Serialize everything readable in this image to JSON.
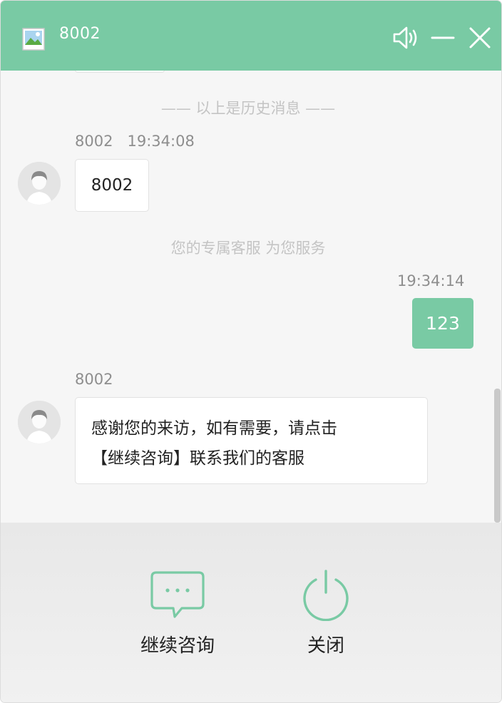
{
  "header": {
    "title": "8002"
  },
  "notes": {
    "history": "—— 以上是历史消息 ——",
    "service": "您的专属客服 为您服务"
  },
  "messages": [
    {
      "sender": "8002",
      "time": "19:34:08",
      "text": "8002"
    },
    {
      "time": "19:34:14",
      "text": "123"
    },
    {
      "sender": "8002",
      "text_line1": "感谢您的来访，如有需要，请点击",
      "text_line2": "【继续咨询】联系我们的客服"
    }
  ],
  "actions": {
    "continue_label": "继续咨询",
    "close_label": "关闭"
  },
  "colors": {
    "brand_green": "#79caa4"
  }
}
